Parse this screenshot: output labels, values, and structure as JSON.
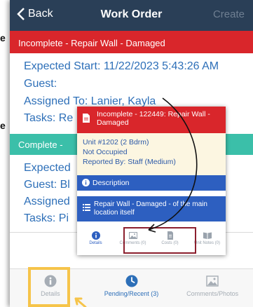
{
  "edge_fragments": [
    "e",
    "e"
  ],
  "navbar": {
    "back_label": "Back",
    "title": "Work Order",
    "create_label": "Create"
  },
  "banner_incomplete": "Incomplete - Repair Wall - Damaged",
  "details": {
    "expected_start": "Expected Start: 11/22/2023 5:43:26 AM",
    "guest": "Guest:",
    "assigned_to": "Assigned To: Lanier, Kayla",
    "tasks": "Tasks: Re"
  },
  "banner_complete": "Complete -",
  "details_second": {
    "expected": "Expected",
    "guest": "Guest: Bl",
    "assigned": "Assigned",
    "tasks": "Tasks: Pi"
  },
  "popup": {
    "header": "Incomplete - 122449: Repair Wall - Damaged",
    "unit": "Unit #1202 (2 Bdrm)",
    "occupancy": "Not Occupied",
    "reported_by": "Reported By: Staff  (Medium)",
    "description_label": "Description",
    "task_text": "Repair Wall - Damaged - of the main location itself",
    "tabs": [
      {
        "label": "Details",
        "icon": "info-icon"
      },
      {
        "label": "Comments (0)",
        "icon": "image-icon"
      },
      {
        "label": "Costs (0)",
        "icon": "receipt-icon"
      },
      {
        "label": "Unit Notes (0)",
        "icon": "book-icon"
      }
    ]
  },
  "bottom_tabs": [
    {
      "label": "Details",
      "icon": "info-icon"
    },
    {
      "label": "Pending/Recent (3)",
      "icon": "clock-icon"
    },
    {
      "label": "Comments/Photos",
      "icon": "image-icon"
    }
  ],
  "colors": {
    "navbar": "#2a3f57",
    "incomplete_red": "#d9262b",
    "complete_teal": "#3bbfa9",
    "link_blue": "#2d6fb8",
    "popup_blue": "#2d5fc0",
    "highlight_yellow": "#f6c44a"
  }
}
